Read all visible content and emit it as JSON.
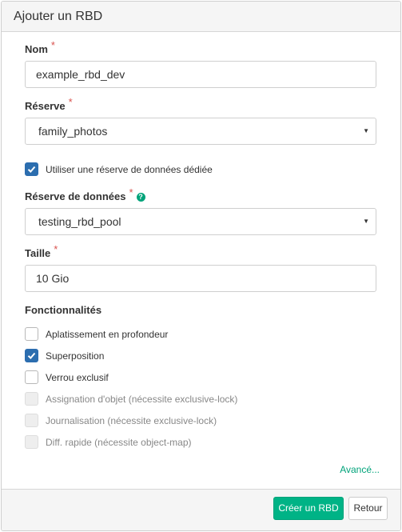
{
  "dialog": {
    "title": "Ajouter un RBD"
  },
  "form": {
    "name": {
      "label": "Nom",
      "required": "*",
      "value": "example_rbd_dev"
    },
    "pool": {
      "label": "Réserve",
      "required": "*",
      "value": "family_photos"
    },
    "dedicated_pool_checkbox": {
      "label": "Utiliser une réserve de données dédiée",
      "checked": true
    },
    "data_pool": {
      "label": "Réserve de données",
      "required": "*",
      "help_icon": "?",
      "value": "testing_rbd_pool"
    },
    "size": {
      "label": "Taille",
      "required": "*",
      "value": "10 Gio"
    },
    "features": {
      "label": "Fonctionnalités",
      "items": [
        {
          "label": "Aplatissement en profondeur",
          "checked": false,
          "disabled": false
        },
        {
          "label": "Superposition",
          "checked": true,
          "disabled": false
        },
        {
          "label": "Verrou exclusif",
          "checked": false,
          "disabled": false
        },
        {
          "label": "Assignation d'objet (nécessite exclusive-lock)",
          "checked": false,
          "disabled": true
        },
        {
          "label": "Journalisation (nécessite exclusive-lock)",
          "checked": false,
          "disabled": true
        },
        {
          "label": "Diff. rapide (nécessite object-map)",
          "checked": false,
          "disabled": true
        }
      ]
    },
    "advanced_link": "Avancé..."
  },
  "footer": {
    "submit_label": "Créer un RBD",
    "back_label": "Retour"
  },
  "colors": {
    "accent": "#00b386",
    "required": "#d9534f",
    "checkbox_checked": "#2c6eaf"
  },
  "icons": {
    "select_caret": "caret-down-icon",
    "help": "help-icon",
    "check": "check-icon"
  }
}
